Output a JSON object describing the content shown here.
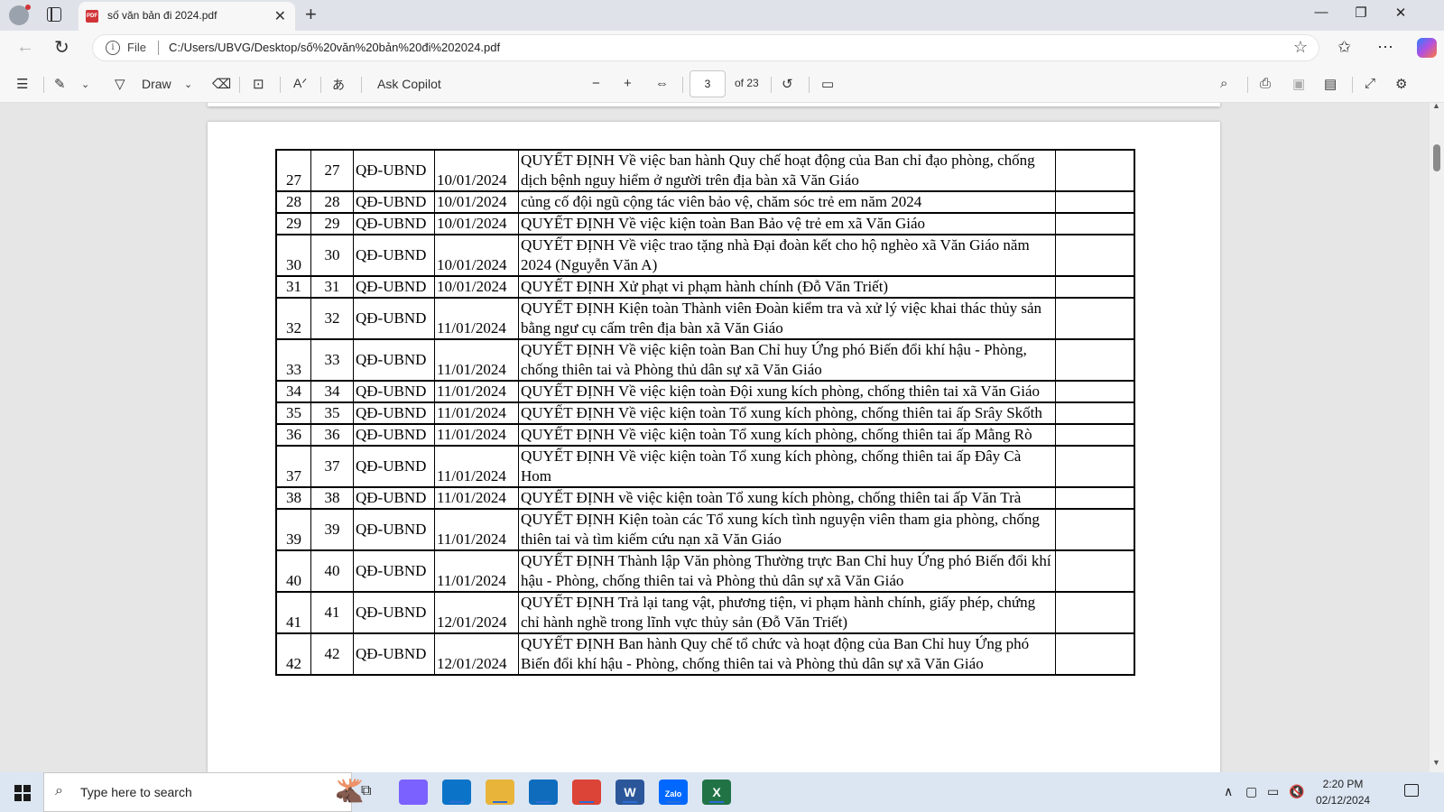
{
  "browser": {
    "tab_title": "số văn bản đi 2024.pdf",
    "tab_icon_text": "PDF",
    "url_scheme_label": "File",
    "url": "C:/Users/UBVG/Desktop/số%20văn%20bản%20đi%202024.pdf"
  },
  "pdf_toolbar": {
    "draw_label": "Draw",
    "ask_copilot_label": "Ask Copilot",
    "current_page": "3",
    "page_total": "of 23"
  },
  "document": {
    "rows": [
      {
        "stt": "27",
        "so": "27",
        "loai": "QĐ-UBND",
        "ngay": "10/01/2024",
        "noidung": "QUYẾT ĐỊNH Về việc ban hành Quy chế hoạt động của Ban chỉ đạo phòng, chống dịch bệnh nguy hiểm ở người trên địa bàn xã Văn Giáo",
        "ghichu": ""
      },
      {
        "stt": "28",
        "so": "28",
        "loai": "QĐ-UBND",
        "ngay": "10/01/2024",
        "noidung": "củng cố đội ngũ cộng tác viên bảo vệ, chăm sóc trẻ em năm 2024",
        "ghichu": ""
      },
      {
        "stt": "29",
        "so": "29",
        "loai": "QĐ-UBND",
        "ngay": "10/01/2024",
        "noidung": "QUYẾT ĐỊNH Về việc kiện toàn Ban Bảo vệ trẻ em xã Văn Giáo",
        "ghichu": ""
      },
      {
        "stt": "30",
        "so": "30",
        "loai": "QĐ-UBND",
        "ngay": "10/01/2024",
        "noidung": "QUYẾT ĐỊNH Về việc trao tặng nhà Đại đoàn kết cho hộ nghèo xã Văn Giáo năm 2024 (Nguyễn Văn A)",
        "ghichu": ""
      },
      {
        "stt": "31",
        "so": "31",
        "loai": "QĐ-UBND",
        "ngay": "10/01/2024",
        "noidung": "QUYẾT ĐỊNH Xử phạt vi phạm hành chính (Đỗ Văn Triết)",
        "ghichu": ""
      },
      {
        "stt": "32",
        "so": "32",
        "loai": "QĐ-UBND",
        "ngay": "11/01/2024",
        "noidung": "QUYẾT ĐỊNH Kiện toàn Thành viên Đoàn kiểm tra và xử lý việc khai thác thủy sản bằng ngư cụ cấm trên địa bàn xã Văn Giáo",
        "ghichu": ""
      },
      {
        "stt": "33",
        "so": "33",
        "loai": "QĐ-UBND",
        "ngay": "11/01/2024",
        "noidung": "QUYẾT ĐỊNH Về việc kiện toàn Ban Chỉ huy Ứng phó Biến đổi khí hậu - Phòng, chống thiên tai và Phòng thủ dân sự xã Văn Giáo",
        "ghichu": ""
      },
      {
        "stt": "34",
        "so": "34",
        "loai": "QĐ-UBND",
        "ngay": "11/01/2024",
        "noidung": "QUYẾT ĐỊNH Về việc kiện toàn Đội xung kích phòng, chống thiên tai xã Văn Giáo",
        "ghichu": ""
      },
      {
        "stt": "35",
        "so": "35",
        "loai": "QĐ-UBND",
        "ngay": "11/01/2024",
        "noidung": "QUYẾT ĐỊNH Về việc kiện toàn Tổ xung kích phòng, chống thiên tai ấp Srây Skốth",
        "ghichu": ""
      },
      {
        "stt": "36",
        "so": "36",
        "loai": "QĐ-UBND",
        "ngay": "11/01/2024",
        "noidung": "QUYẾT ĐỊNH Về việc kiện toàn Tổ xung kích phòng, chống thiên tai ấp Mằng Rò",
        "ghichu": ""
      },
      {
        "stt": "37",
        "so": "37",
        "loai": "QĐ-UBND",
        "ngay": "11/01/2024",
        "noidung": "QUYẾT ĐỊNH Về việc kiện toàn Tổ xung kích phòng, chống thiên tai ấp Đây Cà Hom",
        "ghichu": ""
      },
      {
        "stt": "38",
        "so": "38",
        "loai": "QĐ-UBND",
        "ngay": "11/01/2024",
        "noidung": "QUYẾT ĐỊNH về việc kiện toàn Tổ xung kích phòng, chống thiên tai ấp Văn Trà",
        "ghichu": ""
      },
      {
        "stt": "39",
        "so": "39",
        "loai": "QĐ-UBND",
        "ngay": "11/01/2024",
        "noidung": "QUYẾT ĐỊNH Kiện toàn các Tổ xung kích tình nguyện viên tham gia phòng, chống thiên tai và tìm kiếm cứu nạn xã Văn Giáo",
        "ghichu": ""
      },
      {
        "stt": "40",
        "so": "40",
        "loai": "QĐ-UBND",
        "ngay": "11/01/2024",
        "noidung": "QUYẾT ĐỊNH Thành lập Văn phòng Thường trực Ban Chỉ huy Ứng phó Biến đổi khí hậu - Phòng, chống thiên tai và Phòng thủ dân sự xã Văn Giáo",
        "ghichu": ""
      },
      {
        "stt": "41",
        "so": "41",
        "loai": "QĐ-UBND",
        "ngay": "12/01/2024",
        "noidung": "QUYẾT ĐỊNH Trả lại tang vật, phương tiện, vi phạm hành chính, giấy phép, chứng chỉ hành nghề trong lĩnh vực thủy sản (Đỗ Văn Triết)",
        "ghichu": ""
      },
      {
        "stt": "42",
        "so": "42",
        "loai": "QĐ-UBND",
        "ngay": "12/01/2024",
        "noidung": "QUYẾT ĐỊNH Ban hành Quy chế tổ chức và hoạt động của Ban Chỉ huy Ứng phó Biến đổi khí hậu - Phòng, chống thiên tai và Phòng thủ dân sự xã Văn Giáo",
        "ghichu": ""
      }
    ]
  },
  "taskbar": {
    "search_placeholder": "Type here to search",
    "apps": [
      {
        "name": "copilot",
        "color": "#7b61ff"
      },
      {
        "name": "edge",
        "color": "#0c74c8"
      },
      {
        "name": "file-explorer",
        "color": "#e8b43a"
      },
      {
        "name": "outlook",
        "color": "#0f6cbd"
      },
      {
        "name": "chrome",
        "color": "#db4437"
      },
      {
        "name": "word",
        "color": "#2b579a",
        "letter": "W"
      },
      {
        "name": "zalo",
        "color": "#0068ff",
        "letter": "Zalo"
      },
      {
        "name": "excel",
        "color": "#217346",
        "letter": "X"
      }
    ],
    "time": "2:20 PM",
    "date": "02/12/2024"
  }
}
